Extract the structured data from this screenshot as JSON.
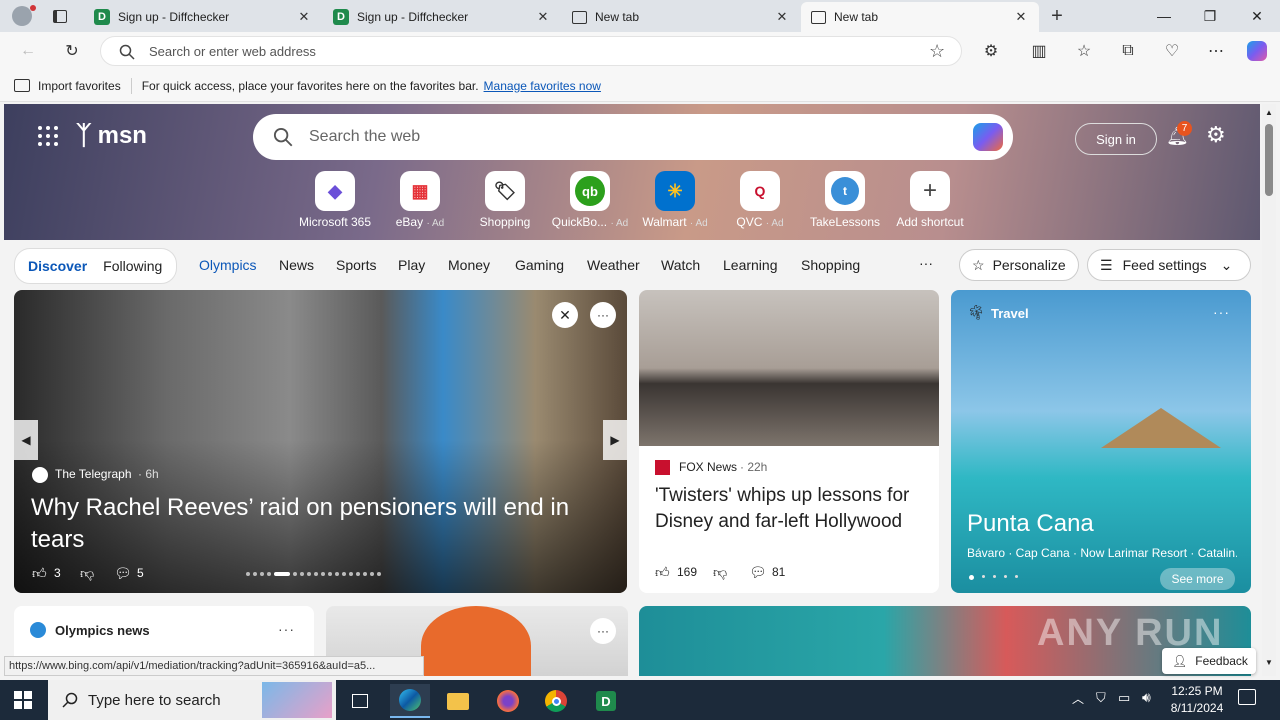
{
  "tabs": [
    {
      "title": "Sign up - Diffchecker"
    },
    {
      "title": "Sign up - Diffchecker"
    },
    {
      "title": "New tab"
    },
    {
      "title": "New tab"
    }
  ],
  "address": {
    "placeholder": "Search or enter web address"
  },
  "favbar": {
    "import_label": "Import favorites",
    "message": "For quick access, place your favorites here on the favorites bar.",
    "manage_link": "Manage favorites now"
  },
  "msn": {
    "logo": "msn",
    "search_placeholder": "Search the web",
    "sign_in": "Sign in",
    "notif_count": "7",
    "shortcuts": [
      {
        "label": "Microsoft 365",
        "ad": ""
      },
      {
        "label": "eBay",
        "ad": "· Ad"
      },
      {
        "label": "Shopping",
        "ad": ""
      },
      {
        "label": "QuickBo...",
        "ad": "· Ad"
      },
      {
        "label": "Walmart",
        "ad": "· Ad"
      },
      {
        "label": "QVC",
        "ad": "· Ad"
      },
      {
        "label": "TakeLessons",
        "ad": ""
      },
      {
        "label": "Add shortcut",
        "ad": ""
      }
    ]
  },
  "nav": {
    "discover": "Discover",
    "following": "Following",
    "items": [
      "Olympics",
      "News",
      "Sports",
      "Play",
      "Money",
      "Gaming",
      "Weather",
      "Watch",
      "Learning",
      "Shopping"
    ],
    "personalize": "Personalize",
    "feed_settings": "Feed settings"
  },
  "main_story": {
    "source": "The Telegraph",
    "age": "· 6h",
    "headline": "Why Rachel Reeves’ raid on pensioners will end in tears",
    "likes": "3",
    "comments": "5"
  },
  "story2": {
    "source": "FOX News",
    "age": "· 22h",
    "headline": "'Twisters' whips up lessons for Disney and far-left Hollywood",
    "likes": "169",
    "comments": "81"
  },
  "travel": {
    "category": "Travel",
    "title": "Punta Cana",
    "places": "Bávaro · Cap Cana · Now Larimar Resort · Catalin...",
    "see_more": "See more"
  },
  "olympics": {
    "title": "Olympics news"
  },
  "status_url": "https://www.bing.com/api/v1/mediation/tracking?adUnit=365916&auId=a5...",
  "feedback": "Feedback",
  "watermark": "ANY RUN",
  "taskbar": {
    "search_placeholder": "Type here to search",
    "time": "12:25 PM",
    "date": "8/11/2024"
  }
}
